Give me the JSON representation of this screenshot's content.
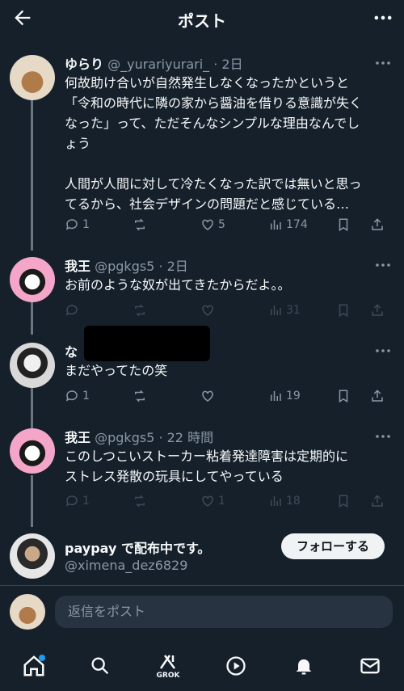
{
  "header": {
    "title": "ポスト",
    "back_icon": "arrow-left-icon",
    "more_icon": "more-horizontal-icon"
  },
  "posts": [
    {
      "name": "ゆらり",
      "handle": "@_yurariyurari_",
      "time": "· 2日",
      "text_lines": [
        "何故助け合いが自然発生しなくなったかというと",
        "「令和の時代に隣の家から醤油を借りる意識が失く",
        "なった」って、ただそんなシンプルな理由なんでし",
        "ょう",
        "",
        "人間が人間に対して冷たくなった訳では無いと思っ",
        "てるから、社会デザインの問題だと感じている…"
      ],
      "replies": "1",
      "reposts": "",
      "likes": "5",
      "views": "174"
    },
    {
      "name": "我王",
      "handle": "@pgkgs5",
      "time": "· 2日",
      "text_lines": [
        "お前のような奴が出てきたからだよ。。"
      ],
      "replies": "",
      "reposts": "",
      "likes": "",
      "views": "31"
    },
    {
      "name": "な",
      "handle": "",
      "time": "",
      "text_lines": [
        "まだやってたの笑"
      ],
      "replies": "1",
      "reposts": "",
      "likes": "",
      "views": "19"
    },
    {
      "name": "我王",
      "handle": "@pgkgs5",
      "time": "· 22 時間",
      "text_lines": [
        "このしつこいストーカー粘着発達障害は定期的に",
        "ストレス発散の玩具にしてやっている"
      ],
      "replies": "1",
      "reposts": "",
      "likes": "1",
      "views": "18"
    }
  ],
  "promo": {
    "name": "paypay で配布中です。",
    "handle": "@ximena_dez6829",
    "follow_label": "フォローする"
  },
  "reply_bar": {
    "placeholder": "返信をポスト"
  },
  "nav": {
    "grok_label": "GROK"
  },
  "colors": {
    "background": "#15202b",
    "muted": "#8b98a5",
    "notification_dot": "#1d9bf0"
  }
}
